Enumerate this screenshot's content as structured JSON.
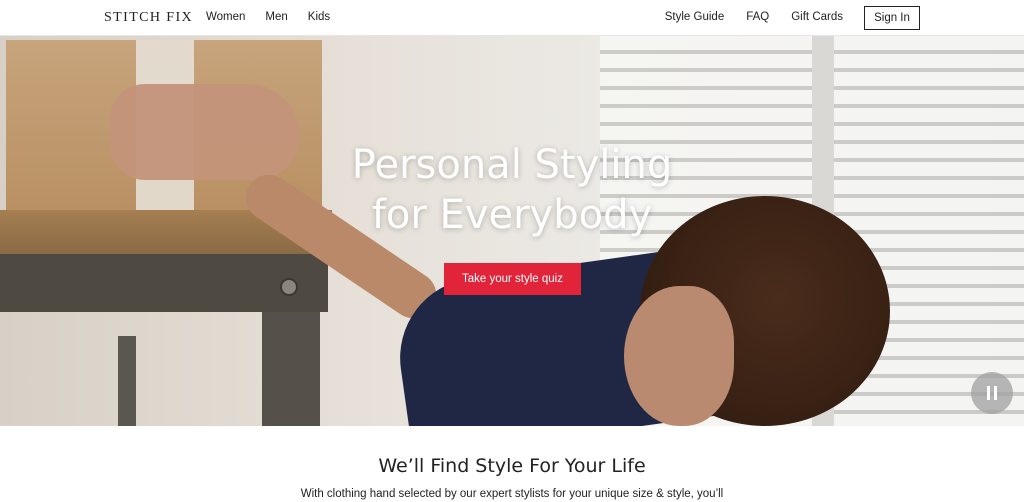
{
  "header": {
    "logo": "STITCH FIX",
    "nav_left": [
      "Women",
      "Men",
      "Kids"
    ],
    "nav_right": [
      "Style Guide",
      "FAQ",
      "Gift Cards"
    ],
    "sign_in": "Sign In"
  },
  "hero": {
    "title_line1": "Personal Styling",
    "title_line2": "for Everybody",
    "cta": "Take your style quiz",
    "cta_color": "#e2243a",
    "pause_icon": "pause-icon"
  },
  "section": {
    "title": "We’ll Find Style For Your Life",
    "text": "With clothing hand selected by our expert stylists for your unique size & style, you’ll"
  }
}
